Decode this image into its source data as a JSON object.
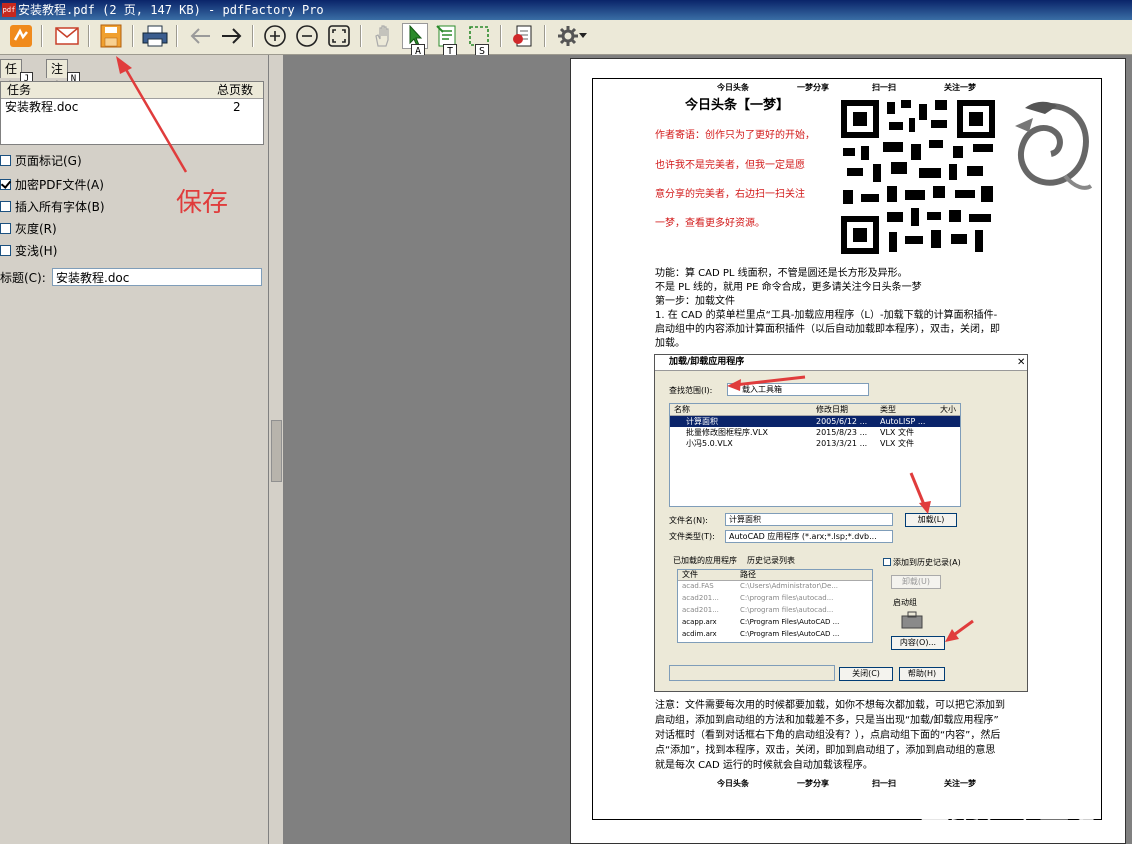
{
  "window": {
    "title": "安装教程.pdf (2 页, 147 KB) - pdfFactory Pro",
    "icon_text": "pdf"
  },
  "toolbar": {
    "keys": {
      "select": "A",
      "text": "T",
      "snapshot": "S"
    }
  },
  "tabs": [
    {
      "label": "任务",
      "key": "J"
    },
    {
      "label": "注意",
      "key": "N"
    }
  ],
  "grid": {
    "headers": [
      "任务",
      "总页数"
    ],
    "rows": [
      {
        "task": "安装教程.doc",
        "pages": "2"
      }
    ]
  },
  "options": [
    {
      "label": "页面标记(G)",
      "checked": false
    },
    {
      "label": "加密PDF文件(A)",
      "checked": true
    },
    {
      "label": "插入所有字体(B)",
      "checked": false
    },
    {
      "label": "灰度(R)",
      "checked": false
    },
    {
      "label": "变浅(H)",
      "checked": false
    }
  ],
  "title_field": {
    "label": "标题(C):",
    "value": "安装教程.doc"
  },
  "annotation": {
    "text": "保存"
  },
  "document": {
    "header_links": [
      "今日头条",
      "一梦分享",
      "扫一扫",
      "关注一梦"
    ],
    "heading": "今日头条【一梦】",
    "red_lines": [
      "作者寄语：创作只为了更好的开始，",
      "也许我不是完美者，但我一定是愿",
      "意分享的完美者，右边扫一扫关注",
      "一梦，查看更多好资源。"
    ],
    "body_lines": [
      "功能：算 CAD    PL 线面积，不管是圆还是长方形及异形。",
      "不是 PL 线的，就用 PE 命令合成，更多请关注今日头条一梦",
      "第一步：加载文件",
      "1. 在 CAD 的菜单栏里点“工具-加载应用程序（L）-加载下载的计算面积插件-",
      "启动组中的内容添加计算面积插件（以后自动加载即本程序），双击，关闭，即",
      "加载。"
    ],
    "note_lines": [
      "注意：文件需要每次用的时候都要加载，如你不想每次都加载，可以把它添加到",
      "启动组，添加到启动组的方法和加载差不多，只是当出现“加载/卸载应用程序”",
      "对话框时（看到对话框右下角的启动组没有？），点启动组下面的“内容”，然后",
      "点“添加”，找到本程序，双击，关闭，即加到启动组了，添加到启动组的意思",
      "就是每次 CAD 运行的时候就会自动加载该程序。"
    ],
    "footer_links": [
      "今日头条",
      "一梦分享",
      "扫一扫",
      "关注一梦"
    ]
  },
  "dialog": {
    "title": "加载/卸载应用程序",
    "lookin_label": "查找范围(I):",
    "lookin_value": "载入工具箱",
    "columns": [
      "名称",
      "修改日期",
      "类型",
      "大小"
    ],
    "files": [
      {
        "name": "计算面积",
        "date": "2005/6/12 ...",
        "type": "AutoLISP ..."
      },
      {
        "name": "批量修改图框程序.VLX",
        "date": "2015/8/23 ...",
        "type": "VLX 文件"
      },
      {
        "name": "小冯5.0.VLX",
        "date": "2013/3/21 ...",
        "type": "VLX 文件"
      }
    ],
    "filename_label": "文件名(N):",
    "filename_value": "计算面积",
    "load_button": "加载(L)",
    "filetype_label": "文件类型(T):",
    "filetype_value": "AutoCAD 应用程序 (*.arx;*.lsp;*.dvb...",
    "loaded_tab": "已加载的应用程序",
    "history_tab": "历史记录列表",
    "add_history": "添加到历史记录(A)",
    "loaded_cols": [
      "文件",
      "路径"
    ],
    "loaded_rows": [
      {
        "file": "acad.FAS",
        "path": "C:\\Users\\Administrator\\De..."
      },
      {
        "file": "acad201...",
        "path": "C:\\program files\\autocad..."
      },
      {
        "file": "acad201...",
        "path": "C:\\program files\\autocad..."
      },
      {
        "file": "acapp.arx",
        "path": "C:\\Program Files\\AutoCAD ..."
      },
      {
        "file": "acdim.arx",
        "path": "C:\\Program Files\\AutoCAD ..."
      }
    ],
    "unload_button": "卸载(U)",
    "startup_group": "启动组",
    "contents_button": "内容(O)...",
    "close_button": "关闭(C)",
    "help_button": "帮助(H)"
  },
  "watermark": "头条号 / 一梦"
}
